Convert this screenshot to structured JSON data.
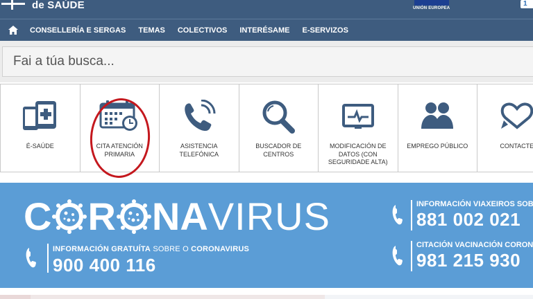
{
  "header": {
    "brand": "de SAÚDE",
    "eu_label": "UNIÓN EUROPEA",
    "corner_badge": "1"
  },
  "nav": {
    "items": [
      "CONSELLERÍA E SERGAS",
      "TEMAS",
      "COLECTIVOS",
      "INTERÉSAME",
      "E-SERVIZOS"
    ]
  },
  "search": {
    "placeholder": "Fai a túa busca..."
  },
  "tiles": [
    {
      "label": "É-SAÚDE",
      "icon": "mobile-health-icon"
    },
    {
      "label": "CITA ATENCIÓN PRIMARIA",
      "icon": "calendar-clock-icon"
    },
    {
      "label": "ASISTENCIA TELEFÓNICA",
      "icon": "phone-icon"
    },
    {
      "label": "BUSCADOR DE CENTROS",
      "icon": "magnifier-icon"
    },
    {
      "label": "MODIFICACIÓN DE DATOS (CON SEGURIDADE ALTA)",
      "icon": "monitor-pulse-icon"
    },
    {
      "label": "EMPREGO PÚBLICO",
      "icon": "people-icon"
    },
    {
      "label": "CONTACTE",
      "icon": "heart-bubble-icon"
    }
  ],
  "banner": {
    "word_bold_1": "C",
    "word_bold_2": "R",
    "word_bold_3": "NA",
    "word_thin": "VIRUS",
    "info_bold_1": "INFORMACIÓN GRATUÍTA",
    "info_light": " SOBRE O ",
    "info_bold_2": "CORONAVIRUS",
    "number_main": "900 400 116",
    "right_1_title": "INFORMACIÓN VIAXEIROS SOBRE",
    "right_1_number": "881 002 021",
    "right_2_title": "CITACIÓN VACINACIÓN CORON",
    "right_2_number": "981 215 930"
  },
  "colors": {
    "header_bg": "#3e5c7f",
    "banner_bg": "#5b9dd6",
    "icon_color": "#3e5c7f",
    "annotation_red": "#c4181e"
  }
}
